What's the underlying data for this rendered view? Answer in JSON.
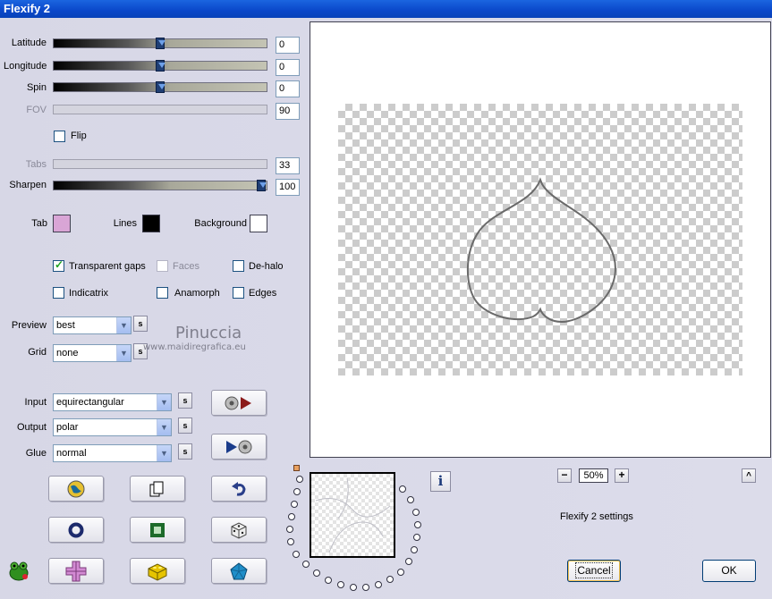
{
  "window": {
    "title": "Flexify 2"
  },
  "sliders": [
    {
      "label": "Latitude",
      "value": "0",
      "level": 0.5,
      "enabled": true
    },
    {
      "label": "Longitude",
      "value": "0",
      "level": 0.5,
      "enabled": true
    },
    {
      "label": "Spin",
      "value": "0",
      "level": 0.5,
      "enabled": true
    },
    {
      "label": "FOV",
      "value": "90",
      "enabled": false
    },
    {
      "label": "Tabs",
      "value": "33",
      "enabled": false
    },
    {
      "label": "Sharpen",
      "value": "100",
      "level": 1.0,
      "enabled": true
    }
  ],
  "flip": {
    "label": "Flip",
    "checked": false
  },
  "colors": {
    "tab": {
      "label": "Tab",
      "color": "#d9a5d6"
    },
    "lines": {
      "label": "Lines",
      "color": "#000000"
    },
    "background": {
      "label": "Background",
      "color": "#ffffff"
    }
  },
  "options": {
    "transparent_gaps": {
      "label": "Transparent gaps",
      "checked": true
    },
    "faces": {
      "label": "Faces",
      "checked": false,
      "enabled": false
    },
    "de_halo": {
      "label": "De-halo",
      "checked": false
    },
    "indicatrix": {
      "label": "Indicatrix",
      "checked": false
    },
    "anamorph": {
      "label": "Anamorph",
      "checked": false
    },
    "edges": {
      "label": "Edges",
      "checked": false
    }
  },
  "dropdowns": {
    "preview": {
      "label": "Preview",
      "value": "best"
    },
    "grid": {
      "label": "Grid",
      "value": "none"
    },
    "input": {
      "label": "Input",
      "value": "equirectangular"
    },
    "output": {
      "label": "Output",
      "value": "polar"
    },
    "glue": {
      "label": "Glue",
      "value": "normal"
    }
  },
  "s_button": "s",
  "watermark": {
    "name": "Pinuccia",
    "url": "www.maidiregrafica.eu"
  },
  "zoom": {
    "minus": "−",
    "value": "50%",
    "plus": "+"
  },
  "up_button": "^",
  "info_button": "i",
  "settings_text": "Flexify 2 settings",
  "buttons": {
    "cancel": "Cancel",
    "ok": "OK"
  },
  "icons": [
    "play-right-icon",
    "play-left-icon",
    "globe-icon",
    "copy-icon",
    "undo-icon",
    "ring-icon",
    "square-icon",
    "dice-icon",
    "cross-icon",
    "cube-icon",
    "pentagon-icon",
    "frog-icon"
  ]
}
